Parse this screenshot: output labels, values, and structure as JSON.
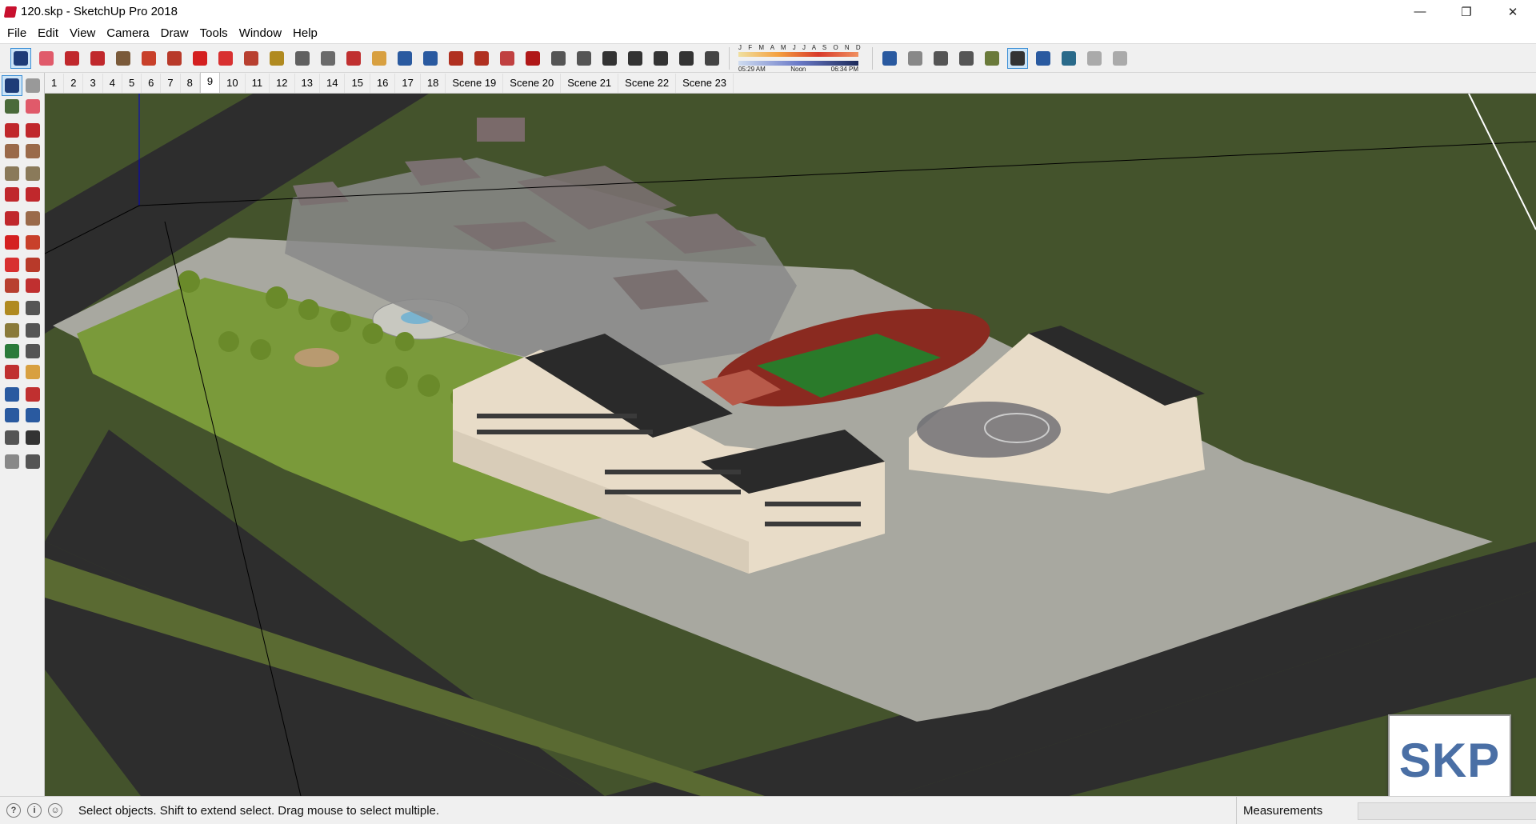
{
  "window": {
    "title": "120.skp - SketchUp Pro 2018",
    "controls": {
      "minimize": "—",
      "restore": "❐",
      "close": "✕"
    }
  },
  "menu": [
    "File",
    "Edit",
    "View",
    "Camera",
    "Draw",
    "Tools",
    "Window",
    "Help"
  ],
  "toolbar": {
    "tools": [
      {
        "name": "select-icon",
        "color": "#1e3c78",
        "active": true
      },
      {
        "name": "eraser-icon",
        "color": "#e05a6a"
      },
      {
        "name": "line-icon",
        "color": "#c0282c"
      },
      {
        "name": "lasso-icon",
        "color": "#c0282c"
      },
      {
        "name": "rectangle-icon",
        "color": "#7a5a3a"
      },
      {
        "name": "push-pull-icon",
        "color": "#c8402a"
      },
      {
        "name": "follow-me-icon",
        "color": "#b83a2a"
      },
      {
        "name": "move-icon",
        "color": "#d42020"
      },
      {
        "name": "rotate-icon",
        "color": "#d83030"
      },
      {
        "name": "scale-icon",
        "color": "#b84030"
      },
      {
        "name": "tape-measure-icon",
        "color": "#b08a20"
      },
      {
        "name": "text-icon",
        "color": "#606060"
      },
      {
        "name": "paint-bucket-icon",
        "color": "#6a6a6a"
      },
      {
        "name": "orbit-icon",
        "color": "#c03030"
      },
      {
        "name": "pan-icon",
        "color": "#d8a040"
      },
      {
        "name": "zoom-icon",
        "color": "#2a5aa0"
      },
      {
        "name": "zoom-extents-icon",
        "color": "#2a5aa0"
      },
      {
        "name": "warehouse-icon",
        "color": "#b03020"
      },
      {
        "name": "share-model-icon",
        "color": "#b03020"
      },
      {
        "name": "component-icon",
        "color": "#c04040"
      },
      {
        "name": "extension-warehouse-icon",
        "color": "#b01818"
      },
      {
        "name": "iso-view-icon",
        "color": "#555555"
      },
      {
        "name": "top-view-icon",
        "color": "#555555"
      },
      {
        "name": "front-view-icon",
        "color": "#333333"
      },
      {
        "name": "right-view-icon",
        "color": "#333333"
      },
      {
        "name": "back-view-icon",
        "color": "#333333"
      },
      {
        "name": "left-view-icon",
        "color": "#333333"
      },
      {
        "name": "shadows-icon",
        "color": "#444444"
      }
    ],
    "months": "J F M A M J J A S O N D",
    "time_start": "05:29 AM",
    "time_noon": "Noon",
    "time_end": "06:34 PM",
    "style_tools": [
      {
        "name": "xray-icon",
        "color": "#2a5aa0"
      },
      {
        "name": "back-edges-icon",
        "color": "#888888"
      },
      {
        "name": "wireframe-icon",
        "color": "#555555"
      },
      {
        "name": "hidden-line-icon",
        "color": "#555555"
      },
      {
        "name": "shaded-icon",
        "color": "#6a7a3a"
      },
      {
        "name": "shaded-textures-icon",
        "color": "#333333",
        "active": true
      },
      {
        "name": "monochrome-icon",
        "color": "#2a5aa0"
      },
      {
        "name": "geo-location-icon",
        "color": "#2a6a8a"
      },
      {
        "name": "toggle-terrain-icon",
        "color": "#aaaaaa"
      },
      {
        "name": "add-location-icon",
        "color": "#aaaaaa"
      }
    ]
  },
  "scenes": {
    "tabs": [
      "1",
      "2",
      "3",
      "4",
      "5",
      "6",
      "7",
      "8",
      "9",
      "10",
      "11",
      "12",
      "13",
      "14",
      "15",
      "16",
      "17",
      "18",
      "Scene 19",
      "Scene 20",
      "Scene 21",
      "Scene 22",
      "Scene 23"
    ],
    "current": "9"
  },
  "left_tools": [
    {
      "name": "select-icon",
      "color": "#1e3c78",
      "active": true
    },
    {
      "name": "make-component-icon",
      "color": "#999999"
    },
    {
      "name": "paint-bucket-icon",
      "color": "#4a6a3a"
    },
    {
      "name": "eraser-icon",
      "color": "#e05a6a"
    },
    {
      "name": "line-icon",
      "color": "#c0282c"
    },
    {
      "name": "freehand-icon",
      "color": "#c0282c"
    },
    {
      "name": "rectangle-icon",
      "color": "#9a6a4a"
    },
    {
      "name": "rotated-rectangle-icon",
      "color": "#9a6a4a"
    },
    {
      "name": "circle-icon",
      "color": "#8a7a5a"
    },
    {
      "name": "polygon-icon",
      "color": "#8a7a5a"
    },
    {
      "name": "arc-icon",
      "color": "#c0282c"
    },
    {
      "name": "two-point-arc-icon",
      "color": "#c0282c"
    },
    {
      "name": "three-point-arc-icon",
      "color": "#c0282c"
    },
    {
      "name": "pie-icon",
      "color": "#9a6a4a"
    },
    {
      "name": "move-icon",
      "color": "#d42020"
    },
    {
      "name": "push-pull-icon",
      "color": "#c8402a"
    },
    {
      "name": "rotate-icon",
      "color": "#d83030"
    },
    {
      "name": "follow-me-icon",
      "color": "#b83a2a"
    },
    {
      "name": "scale-icon",
      "color": "#b84030"
    },
    {
      "name": "offset-icon",
      "color": "#c03030"
    },
    {
      "name": "tape-measure-icon",
      "color": "#b08a20"
    },
    {
      "name": "dimension-icon",
      "color": "#555555"
    },
    {
      "name": "protractor-icon",
      "color": "#8a7a3a"
    },
    {
      "name": "text-icon",
      "color": "#555555"
    },
    {
      "name": "axes-icon",
      "color": "#2a7a3a"
    },
    {
      "name": "3d-text-icon",
      "color": "#555555"
    },
    {
      "name": "orbit-icon",
      "color": "#c03030"
    },
    {
      "name": "pan-icon",
      "color": "#d8a040"
    },
    {
      "name": "zoom-icon",
      "color": "#2a5aa0"
    },
    {
      "name": "zoom-window-icon",
      "color": "#c03030"
    },
    {
      "name": "zoom-extents-icon",
      "color": "#2a5aa0"
    },
    {
      "name": "previous-view-icon",
      "color": "#2a5aa0"
    },
    {
      "name": "position-camera-icon",
      "color": "#555555"
    },
    {
      "name": "look-around-icon",
      "color": "#333333"
    },
    {
      "name": "walk-icon",
      "color": "#888888"
    },
    {
      "name": "section-plane-icon",
      "color": "#555555"
    }
  ],
  "viewport": {
    "logo_text": "SKP"
  },
  "status": {
    "text": "Select objects. Shift to extend select. Drag mouse to select multiple.",
    "measurements_label": "Measurements",
    "measurements_value": "",
    "icons": [
      "geo-location-status-icon",
      "credits-icon",
      "user-account-icon"
    ]
  }
}
